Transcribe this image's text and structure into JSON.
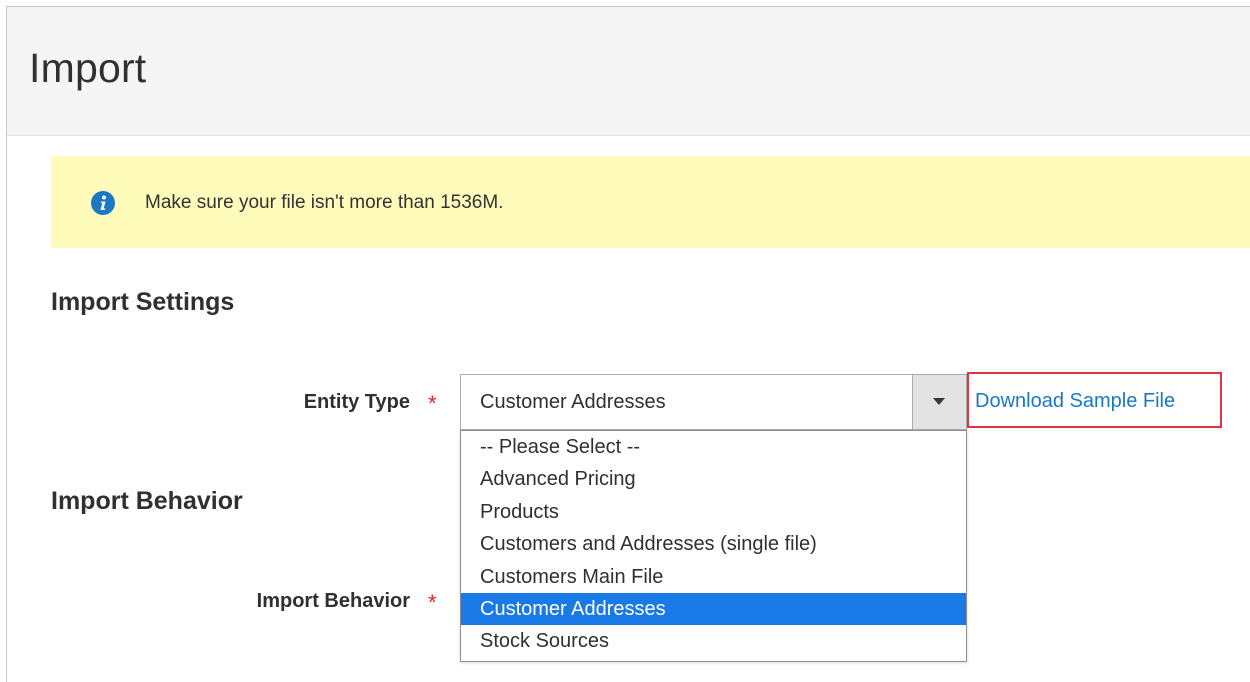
{
  "header": {
    "title": "Import"
  },
  "notice": {
    "icon": "info-icon",
    "text": "Make sure your file isn't more than 1536M."
  },
  "sections": {
    "settings_title": "Import Settings",
    "behavior_title": "Import Behavior"
  },
  "entity_type": {
    "label": "Entity Type",
    "required_marker": "*",
    "selected_value": "Customer Addresses",
    "options": [
      "-- Please Select --",
      "Advanced Pricing",
      "Products",
      "Customers and Addresses (single file)",
      "Customers Main File",
      "Customer Addresses",
      "Stock Sources"
    ],
    "selected_index": 5
  },
  "download_sample": {
    "label": "Download Sample File"
  },
  "import_behavior": {
    "label": "Import Behavior",
    "required_marker": "*"
  },
  "colors": {
    "accent": "#1979c3",
    "selected_option": "#1979e6",
    "notice_bg": "#fffbbb",
    "required": "#e22626",
    "highlight_box": "#e0353e"
  }
}
